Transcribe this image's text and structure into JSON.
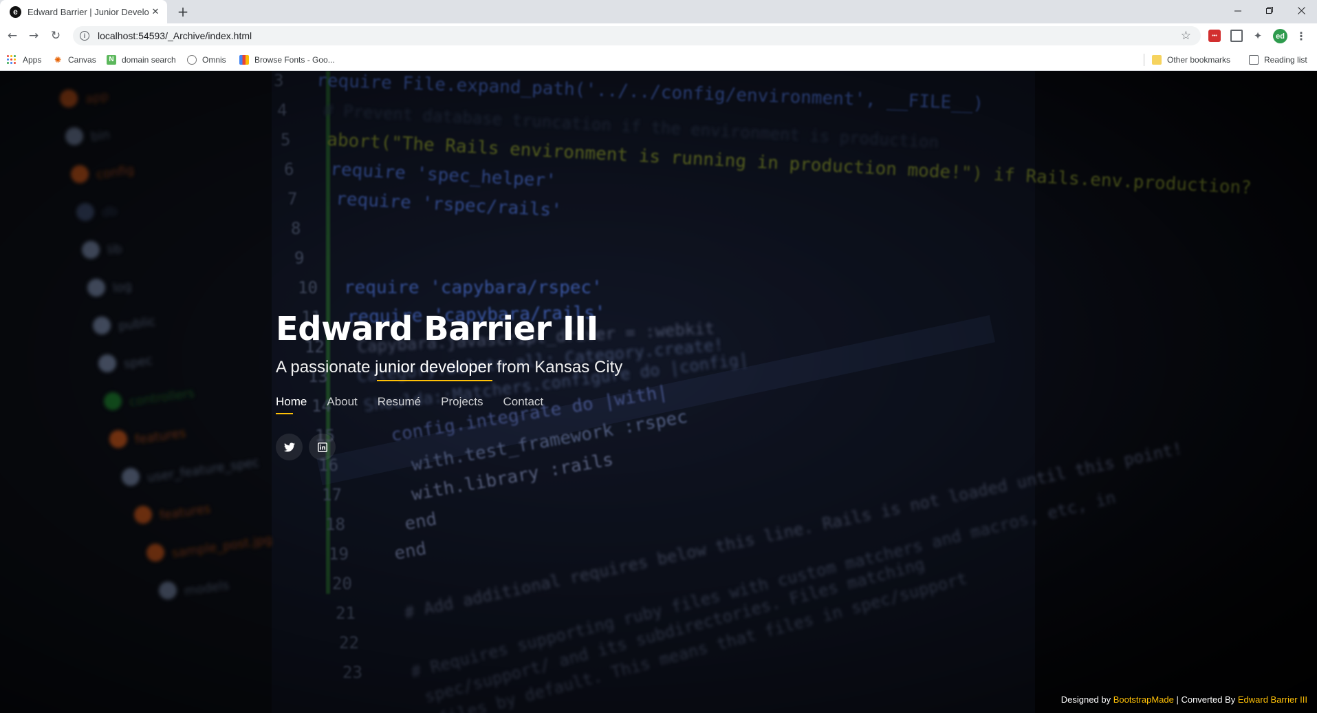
{
  "browser": {
    "tab_title": "Edward Barrier | Junior Developer",
    "url": "localhost:54593/_Archive/index.html",
    "avatar_initials": "ed",
    "bookmarks": [
      {
        "label": "Apps",
        "icon": "apps-grid-icon"
      },
      {
        "label": "Canvas",
        "icon": "canvas-icon"
      },
      {
        "label": "domain search",
        "icon": "namecheap-icon"
      },
      {
        "label": "Omnis",
        "icon": "omnis-icon"
      },
      {
        "label": "Browse Fonts - Goo...",
        "icon": "google-fonts-icon"
      }
    ],
    "other_bookmarks": "Other bookmarks",
    "reading_list": "Reading list"
  },
  "hero": {
    "name": "Edward Barrier III",
    "tagline_prefix": "A passionate ",
    "tagline_highlight": "junior developer",
    "tagline_suffix": " from Kansas City",
    "nav": [
      "Home",
      "About",
      "Resumé",
      "Projects",
      "Contact"
    ],
    "active_nav": "Home",
    "socials": [
      "twitter-icon",
      "linkedin-icon"
    ]
  },
  "footer": {
    "designed_by": "Designed by ",
    "designer": "BootstrapMade",
    "separator": " | Converted By ",
    "converter": "Edward Barrier III"
  },
  "colors": {
    "accent": "#ffc107",
    "hero_text": "#ffffff",
    "chrome_tabbar": "#dee1e6",
    "avatar": "#2e9b4d"
  },
  "background_code": {
    "line_numbers": [
      "3",
      "4",
      "5",
      "6",
      "7",
      "8",
      "9",
      "10",
      "11",
      "12",
      "13",
      "14",
      "15",
      "16",
      "17",
      "18",
      "19",
      "20",
      "21",
      "22",
      "23"
    ],
    "lines": [
      "require File.expand_path('../../config/environment', __FILE__)",
      "# Prevent database truncation if the environment is production",
      "abort(\"The Rails environment is running in production mode!\") if Rails.env.production?",
      "require 'spec_helper'",
      "require 'rspec/rails'",
      "require 'capybara/rspec'",
      "require 'capybara/rails'",
      "Capybara.javascript_driver = :webkit",
      "Category.delete_all; Category.create!",
      "Shoulda::Matchers.configure do |config|",
      "config.integrate do |with|",
      "with.test_framework :rspec",
      "with.library :rails",
      "end",
      "end",
      "# Add additional requires below this line. Rails is not loaded until this point!",
      "# Requires supporting ruby files with custom matchers and macros, etc, in",
      "spec/support/ and its subdirectories. Files matching",
      "files by default. This means that files in spec/support"
    ],
    "tree_items": [
      "app",
      "bin",
      "config",
      "db",
      "lib",
      "log",
      "public",
      "spec",
      "controllers",
      "features",
      "user_feature_spec",
      "features",
      "sample_post.jpg",
      "models"
    ]
  }
}
